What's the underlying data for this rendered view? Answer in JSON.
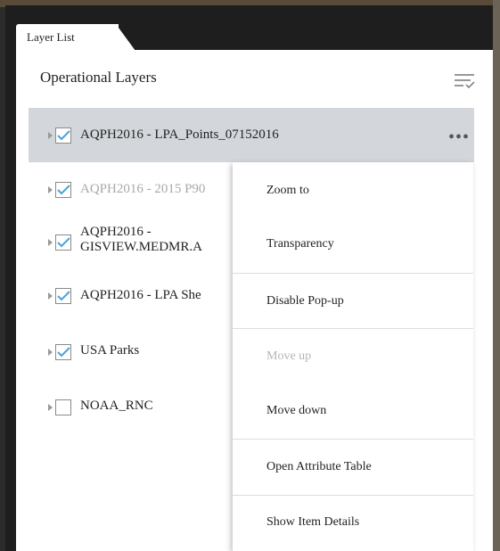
{
  "panel": {
    "tab_label": "Layer List",
    "title": "Operational Layers",
    "filter_icon": "filter-list-icon"
  },
  "layers": [
    {
      "label": "AQPH2016 - LPA_Points_07152016",
      "checked": true,
      "selected": true,
      "dim": false
    },
    {
      "label": "AQPH2016 - 2015 P90",
      "checked": true,
      "selected": false,
      "dim": true
    },
    {
      "label_line1": "AQPH2016 -",
      "label_line2": "GISVIEW.MEDMR.A",
      "checked": true,
      "selected": false,
      "dim": false
    },
    {
      "label": "AQPH2016 - LPA She",
      "checked": true,
      "selected": false,
      "dim": false
    },
    {
      "label": "USA Parks",
      "checked": true,
      "selected": false,
      "dim": false
    },
    {
      "label": "NOAA_RNC",
      "checked": false,
      "selected": false,
      "dim": false
    }
  ],
  "more_icon": "•••",
  "menu": {
    "items": [
      {
        "label": "Zoom to",
        "disabled": false
      },
      {
        "label": "Transparency",
        "disabled": false
      },
      {
        "label": "Disable Pop-up",
        "disabled": false
      },
      {
        "label": "Move up",
        "disabled": true
      },
      {
        "label": "Move down",
        "disabled": false
      },
      {
        "label": "Open Attribute Table",
        "disabled": false
      },
      {
        "label": "Show Item Details",
        "disabled": false
      }
    ]
  },
  "colors": {
    "checkbox_check": "#4aa3d8",
    "selected_row": "#d3d7db",
    "panel_frame": "#1e1e1e"
  }
}
